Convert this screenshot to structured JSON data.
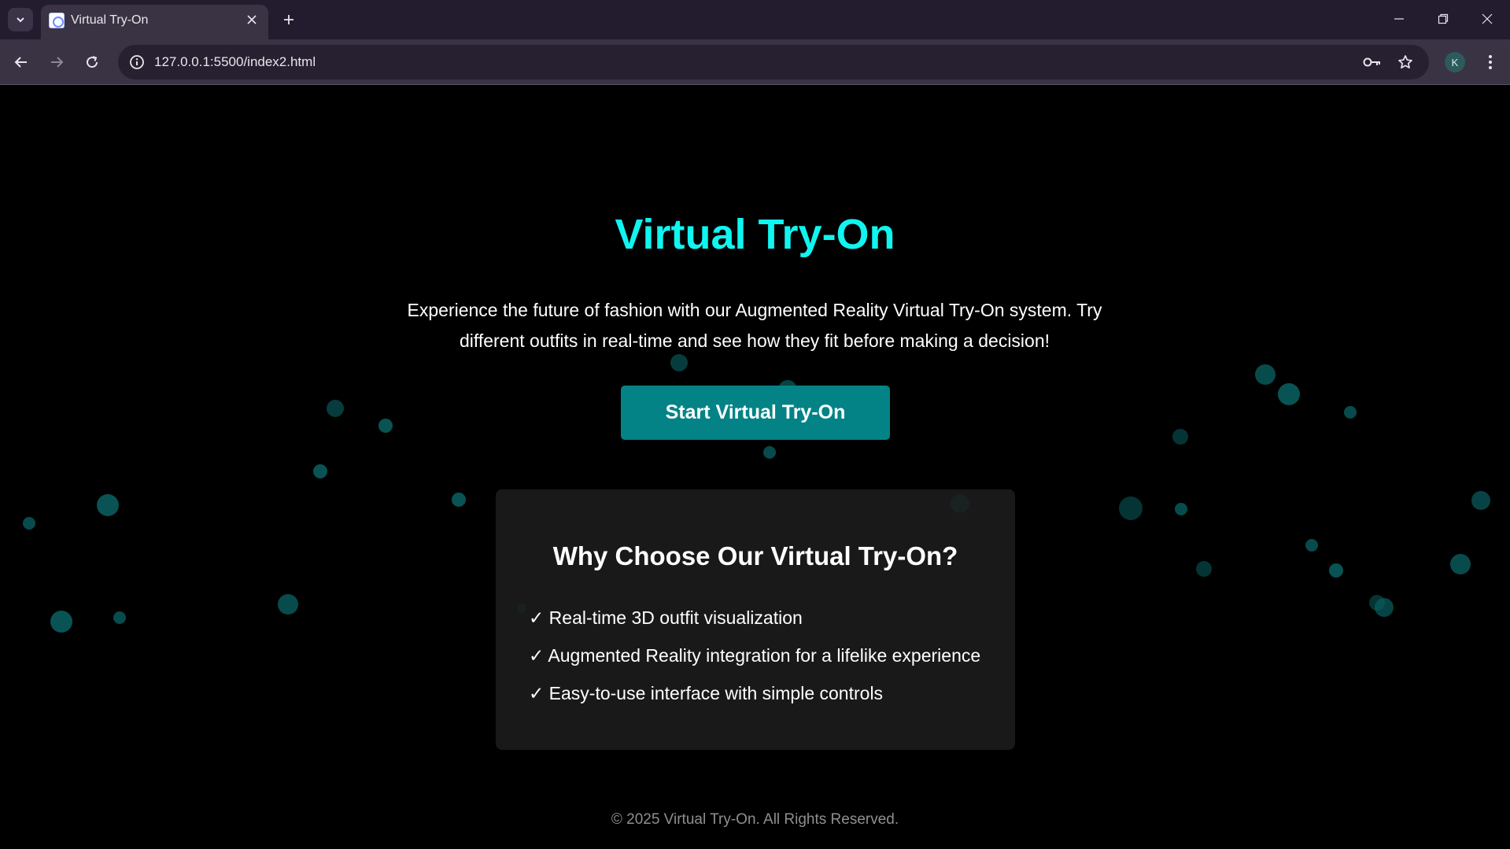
{
  "browser": {
    "tab_title": "Virtual Try-On",
    "url": "127.0.0.1:5500/index2.html",
    "profile_initial": "K"
  },
  "page": {
    "title": "Virtual Try-On",
    "description": "Experience the future of fashion with our Augmented Reality Virtual Try-On system. Try different outfits in real-time and see how they fit before making a decision!",
    "cta_label": "Start Virtual Try-On",
    "features": {
      "title": "Why Choose Our Virtual Try-On?",
      "items": [
        "✓ Real-time 3D outfit visualization",
        "✓ Augmented Reality integration for a lifelike experience",
        "✓ Easy-to-use interface with simple controls"
      ]
    },
    "footer": "© 2025 Virtual Try-On. All Rights Reserved."
  },
  "colors": {
    "accent": "#0ff5f0",
    "button": "#038385",
    "particle": "#0a5f60",
    "background": "#000000"
  }
}
